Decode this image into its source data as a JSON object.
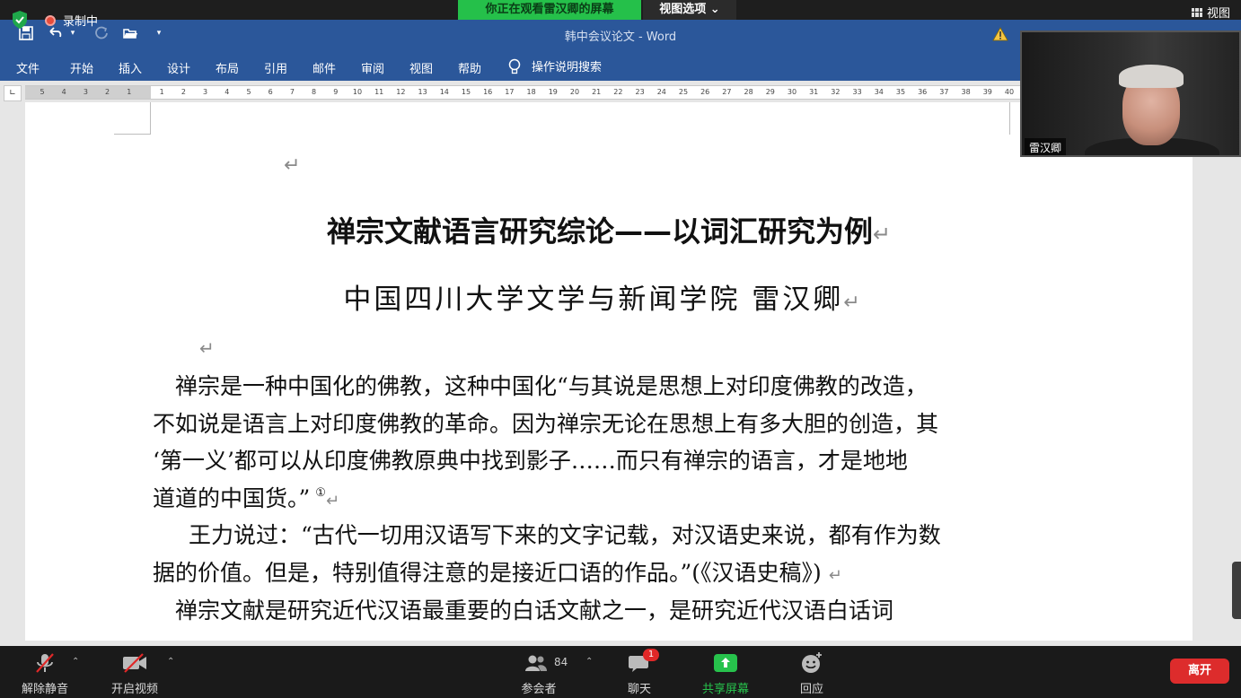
{
  "zoom": {
    "recording_label": "录制中",
    "sharing_banner": "你正在观看雷汉卿的屏幕",
    "view_options": "视图选项 ⌄",
    "view_top": "视图",
    "participant_name": "雷汉卿",
    "participants_count": "84",
    "chat_badge": "1",
    "toolbar": {
      "unmute": "解除静音",
      "start_video": "开启视频",
      "participants": "参会者",
      "chat": "聊天",
      "share": "共享屏幕",
      "reactions": "回应",
      "leave": "离开"
    },
    "colors": {
      "share_banner": "#25c04a",
      "leave": "#dd2c2c",
      "share_icon": "#27c24c"
    }
  },
  "word": {
    "title": "韩中会议论文 - Word",
    "tabs": [
      "文件",
      "开始",
      "插入",
      "设计",
      "布局",
      "引用",
      "邮件",
      "审阅",
      "视图",
      "帮助"
    ],
    "tell_me": "操作说明搜索",
    "ruler_left": [
      "5",
      "4",
      "3",
      "2",
      "1"
    ],
    "ruler_right": [
      "1",
      "2",
      "3",
      "4",
      "5",
      "6",
      "7",
      "8",
      "9",
      "10",
      "11",
      "12",
      "13",
      "14",
      "15",
      "16",
      "17",
      "18",
      "19",
      "20",
      "21",
      "22",
      "23",
      "24",
      "25",
      "26",
      "27",
      "28",
      "29",
      "30",
      "31",
      "32",
      "33",
      "34",
      "35",
      "36",
      "37",
      "38",
      "39",
      "40"
    ],
    "accent_color": "#2b579a"
  },
  "document": {
    "title": "禅宗文献语言研究综论——以词汇研究为例",
    "subtitle": "中国四川大学文学与新闻学院 雷汉卿",
    "paragraph_mark": "↵",
    "p1_lines": [
      "　禅宗是一种中国化的佛教，这种中国化“与其说是思想上对印度佛教的改造，",
      "不如说是语言上对印度佛教的革命。因为禅宗无论在思想上有多大胆的创造，其",
      "‘第一义’都可以从印度佛教原典中找到影子……而只有禅宗的语言，才是地地",
      "道道的中国货。”"
    ],
    "footnote_ref": "①",
    "p2_lines": [
      "王力说过：“古代一切用汉语写下来的文字记载，对汉语史来说，都有作为数",
      "据的价值。但是，特别值得注意的是接近口语的作品。”(《汉语史稿》)"
    ],
    "p3_line": "　禅宗文献是研究近代汉语最重要的白话文献之一，是研究近代汉语白话词"
  }
}
